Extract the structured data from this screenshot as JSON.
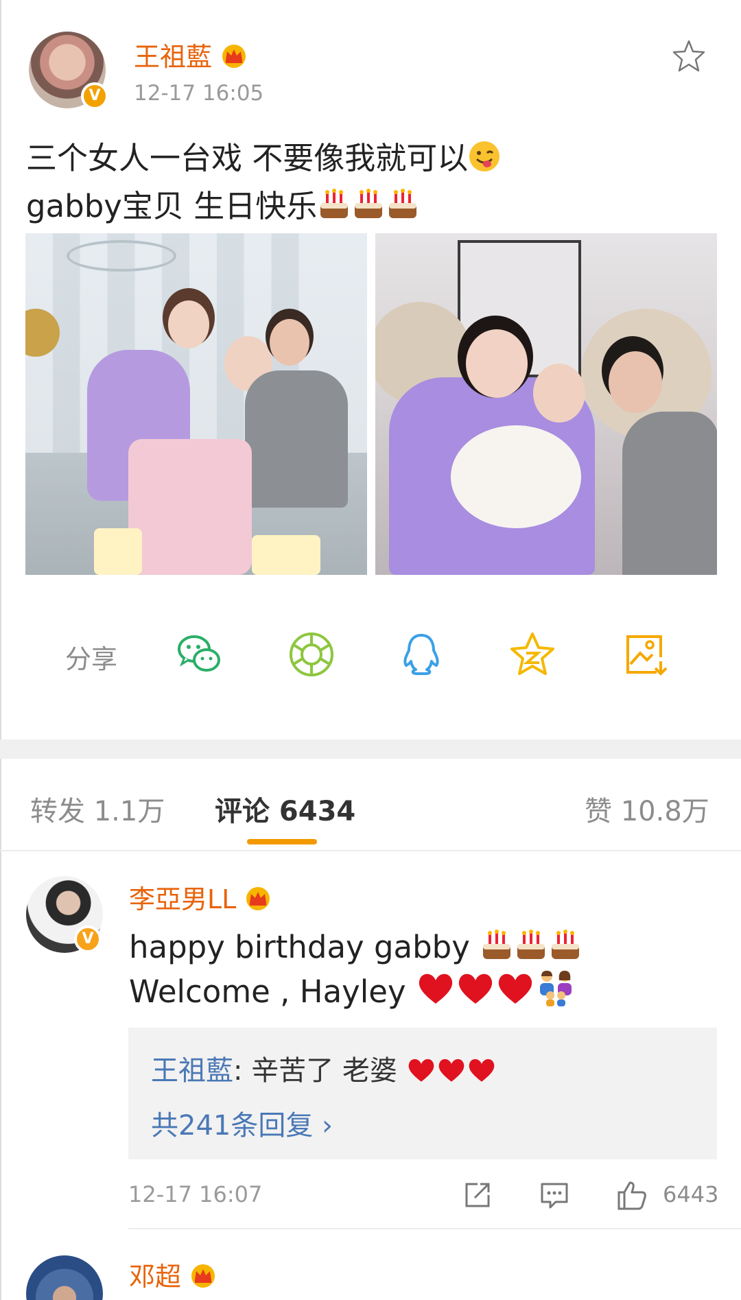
{
  "post": {
    "author": "王祖藍",
    "time": "12-17 16:05",
    "line1": "三个女人一台戏 不要像我就可以",
    "line2": "gabby宝贝 生日快乐"
  },
  "share": {
    "label": "分享",
    "icons": [
      "wechat-icon",
      "moments-icon",
      "qq-icon",
      "qzone-icon",
      "save-image-icon"
    ]
  },
  "tabs": {
    "repost": "转发 1.1万",
    "comments": "评论 6434",
    "likes": "赞 10.8万"
  },
  "comment": {
    "author": "李亞男LL",
    "line1": "happy birthday gabby",
    "line2": "Welcome , Hayley",
    "reply_author": "王祖藍",
    "reply_text": ": 辛苦了 老婆",
    "reply_more": "共241条回复 ›",
    "time": "12-17 16:07",
    "like_count": "6443"
  },
  "next_comment": {
    "author": "邓超"
  },
  "colors": {
    "name_orange": "#e8630a",
    "accent_orange": "#f39800",
    "link_blue": "#4a78b5",
    "wechat_green": "#2aae67",
    "moments_green": "#8dc63f",
    "qq_blue": "#3aa0e6",
    "qzone_yellow": "#f5b800"
  }
}
